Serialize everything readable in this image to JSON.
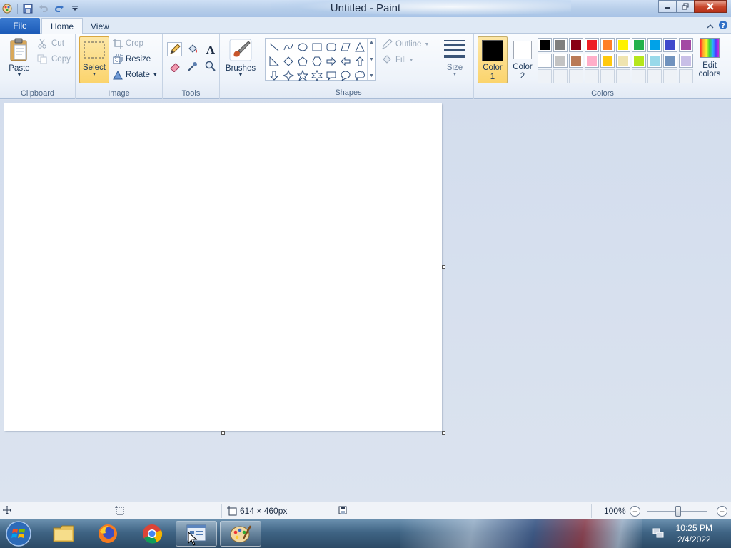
{
  "window": {
    "title": "Untitled - Paint"
  },
  "tabs": {
    "file": "File",
    "home": "Home",
    "view": "View"
  },
  "clipboard": {
    "paste": "Paste",
    "cut": "Cut",
    "copy": "Copy",
    "group_label": "Clipboard"
  },
  "image": {
    "select": "Select",
    "crop": "Crop",
    "resize": "Resize",
    "rotate": "Rotate",
    "group_label": "Image"
  },
  "tools": {
    "group_label": "Tools",
    "items": [
      "pencil-icon",
      "fill-bucket-icon",
      "text-icon",
      "eraser-icon",
      "color-picker-icon",
      "magnifier-icon"
    ]
  },
  "brushes": {
    "label": "Brushes"
  },
  "shapes": {
    "group_label": "Shapes",
    "outline": "Outline",
    "fill": "Fill",
    "items": [
      "line",
      "curve",
      "oval",
      "rectangle",
      "rounded-rectangle",
      "polygon",
      "triangle",
      "right-triangle",
      "diamond",
      "pentagon",
      "hexagon",
      "right-arrow",
      "left-arrow",
      "up-arrow",
      "down-arrow",
      "four-point-star",
      "five-point-star",
      "six-point-star",
      "rect-callout",
      "oval-callout",
      "cloud-callout"
    ]
  },
  "size": {
    "label": "Size"
  },
  "colors": {
    "group_label": "Colors",
    "color1_label": "Color",
    "color1_num": "1",
    "color1_value": "#000000",
    "color2_label": "Color",
    "color2_num": "2",
    "color2_value": "#ffffff",
    "edit_label": "Edit",
    "edit_label2": "colors",
    "palette": [
      "#000000",
      "#7f7f7f",
      "#880015",
      "#ed1c24",
      "#ff7f27",
      "#fff200",
      "#22b14c",
      "#00a2e8",
      "#3f48cc",
      "#a349a4",
      "#ffffff",
      "#c3c3c3",
      "#b97a57",
      "#ffaec9",
      "#ffc90e",
      "#efe4b0",
      "#b5e61d",
      "#99d9ea",
      "#7092be",
      "#c8bfe7"
    ]
  },
  "status": {
    "image_size": "614 × 460px",
    "zoom": "100%"
  },
  "taskbar": {
    "time": "10:25 PM",
    "date": "2/4/2022"
  }
}
